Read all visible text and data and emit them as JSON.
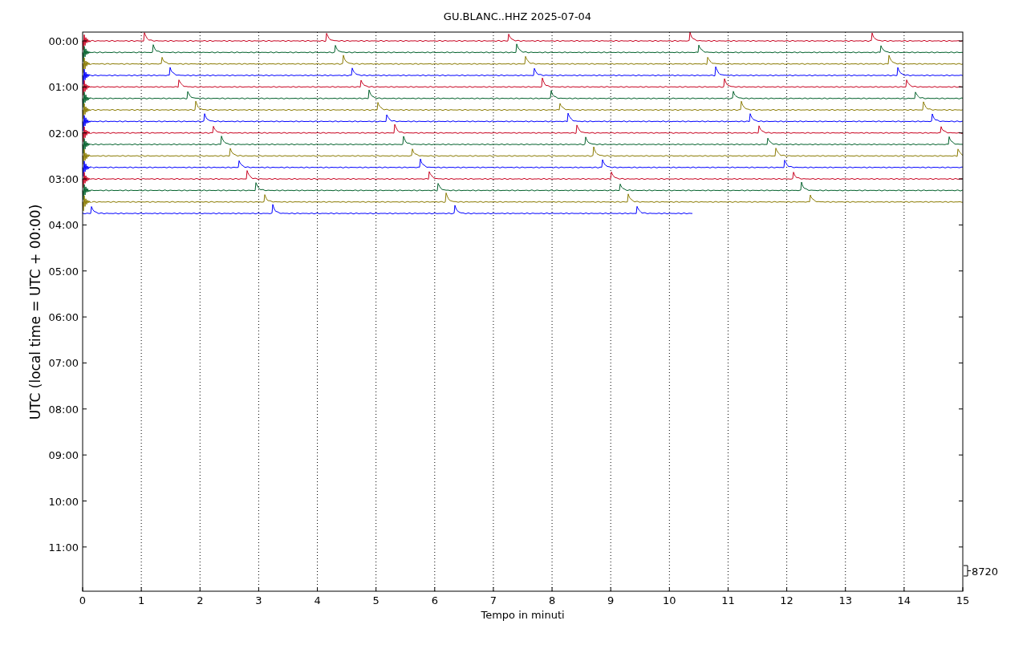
{
  "title": "GU.BLANC..HHZ 2025-07-04",
  "xlabel": "Tempo in minuti",
  "ylabel": "UTC (local time = UTC + 00:00)",
  "xticks": [
    "0",
    "1",
    "2",
    "3",
    "4",
    "5",
    "6",
    "7",
    "8",
    "9",
    "10",
    "11",
    "12",
    "13",
    "14",
    "15"
  ],
  "yticks": [
    "00:00",
    "01:00",
    "02:00",
    "03:00",
    "04:00",
    "05:00",
    "06:00",
    "07:00",
    "08:00",
    "09:00",
    "10:00",
    "11:00"
  ],
  "scale_label": "8720",
  "traces": [
    {
      "color": "#c8001e",
      "level": 1
    },
    {
      "color": "#00602a",
      "level": 1
    },
    {
      "color": "#8a7a00",
      "level": 1
    },
    {
      "color": "#0000ff",
      "level": 1
    },
    {
      "color": "#c8001e",
      "level": 1
    },
    {
      "color": "#00602a",
      "level": 1
    },
    {
      "color": "#8a7a00",
      "level": 1
    },
    {
      "color": "#0000ff",
      "level": 1
    },
    {
      "color": "#c8001e",
      "level": 1
    },
    {
      "color": "#00602a",
      "level": 1
    },
    {
      "color": "#8a7a00",
      "level": 1
    },
    {
      "color": "#0000ff",
      "level": 1
    },
    {
      "color": "#c8001e",
      "level": 1
    },
    {
      "color": "#00602a",
      "level": 1
    },
    {
      "color": "#8a7a00",
      "level": 1
    },
    {
      "color": "#0000ff",
      "level": 0.693
    }
  ]
}
